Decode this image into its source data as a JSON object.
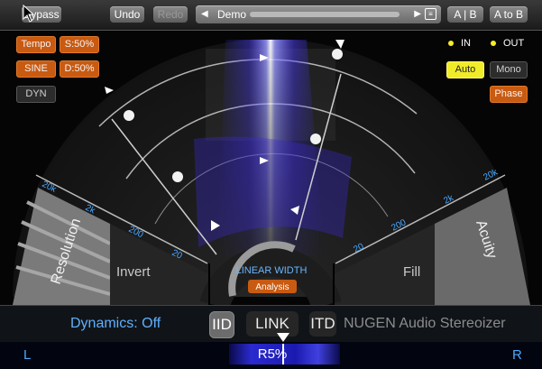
{
  "toolbar": {
    "bypass_label": "Bypass",
    "undo_label": "Undo",
    "redo_label": "Redo",
    "preset_name": "Demo",
    "ab_label": "A | B",
    "atob_label": "A to B"
  },
  "left_buttons": {
    "tempo": "Tempo",
    "s50": "S:50%",
    "sine": "SINE",
    "d50": "D:50%",
    "dyn": "DYN"
  },
  "right_controls": {
    "in_label": "IN",
    "out_label": "OUT",
    "auto": "Auto",
    "mono": "Mono",
    "phase": "Phase"
  },
  "dial": {
    "left_freqs": [
      "20k",
      "2k",
      "200",
      "20"
    ],
    "right_freqs": [
      "20k",
      "2k",
      "200",
      "20"
    ],
    "resolution_label": "Resolution",
    "invert_label": "Invert",
    "fill_label": "Fill",
    "acuity_label": "Acuity",
    "linear_width_label": "LINEAR WIDTH",
    "analysis_label": "Analysis"
  },
  "footer": {
    "dynamics_label": "Dynamics: Off",
    "iid_label": "IID",
    "link_label": "LINK",
    "itd_label": "ITD",
    "brand_label": "NUGEN Audio Stereoizer"
  },
  "balance": {
    "left_label": "L",
    "right_label": "R",
    "value_label": "R5%"
  },
  "colors": {
    "accent_blue": "#4aa8ff",
    "orange": "#c85a12",
    "yellow": "#f0ec2a"
  }
}
